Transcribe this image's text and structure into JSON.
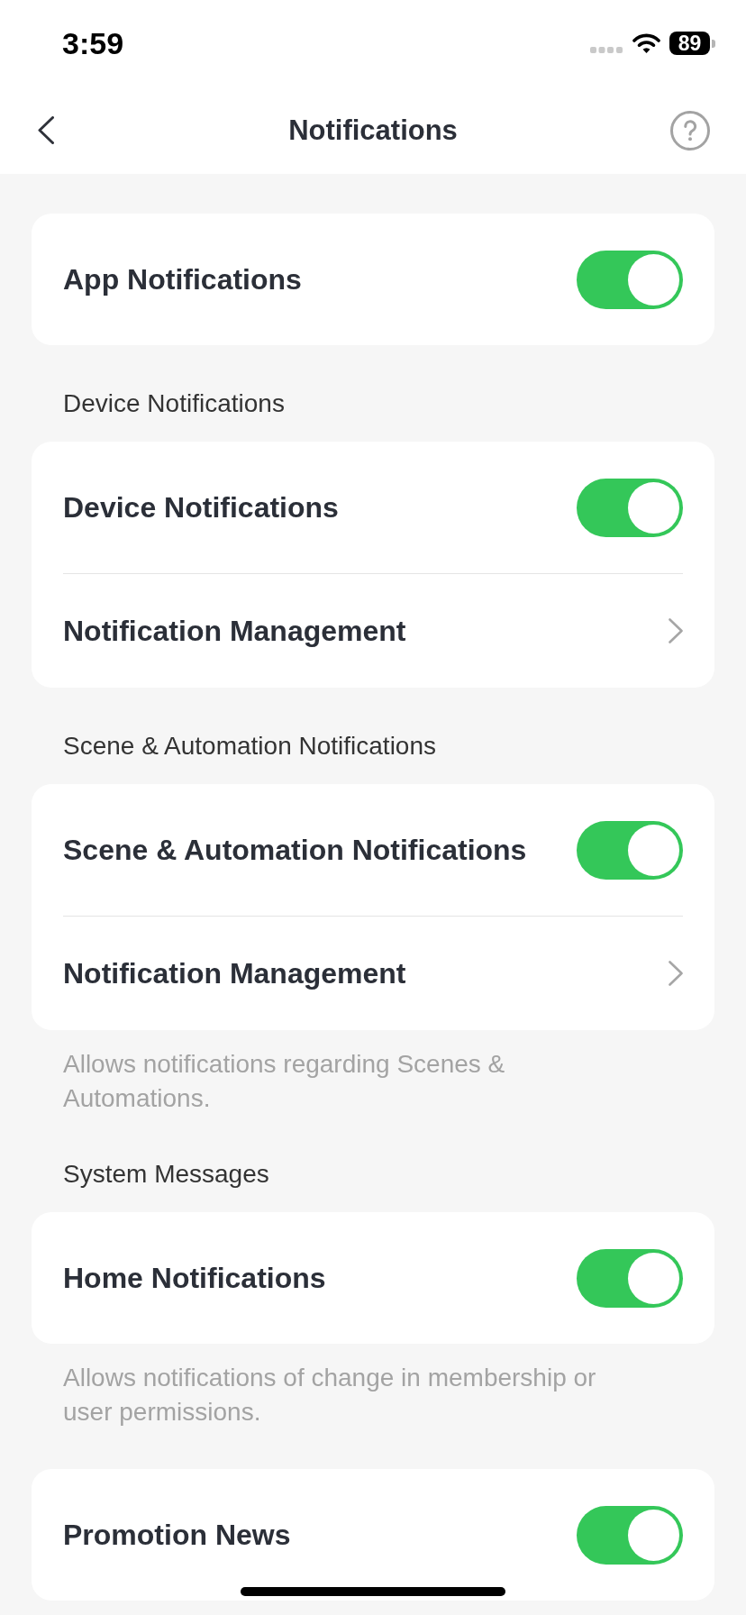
{
  "status_bar": {
    "time": "3:59",
    "battery": "89"
  },
  "nav_bar": {
    "title": "Notifications"
  },
  "sections": [
    {
      "rows": [
        {
          "kind": "toggle",
          "label": "App Notifications",
          "on": true
        }
      ]
    },
    {
      "header": "Device Notifications",
      "rows": [
        {
          "kind": "toggle",
          "label": "Device Notifications",
          "on": true
        },
        {
          "kind": "link",
          "label": "Notification Management"
        }
      ]
    },
    {
      "header": "Scene & Automation Notifications",
      "rows": [
        {
          "kind": "toggle",
          "label": "Scene & Automation Notifications",
          "on": true
        },
        {
          "kind": "link",
          "label": "Notification Management"
        }
      ],
      "footer": "Allows notifications regarding Scenes & Automations."
    },
    {
      "header": "System Messages",
      "rows": [
        {
          "kind": "toggle",
          "label": "Home Notifications",
          "on": true
        }
      ],
      "footer": "Allows notifications of change in membership or user permissions."
    },
    {
      "rows": [
        {
          "kind": "toggle",
          "label": "Promotion News",
          "on": true
        }
      ]
    }
  ]
}
